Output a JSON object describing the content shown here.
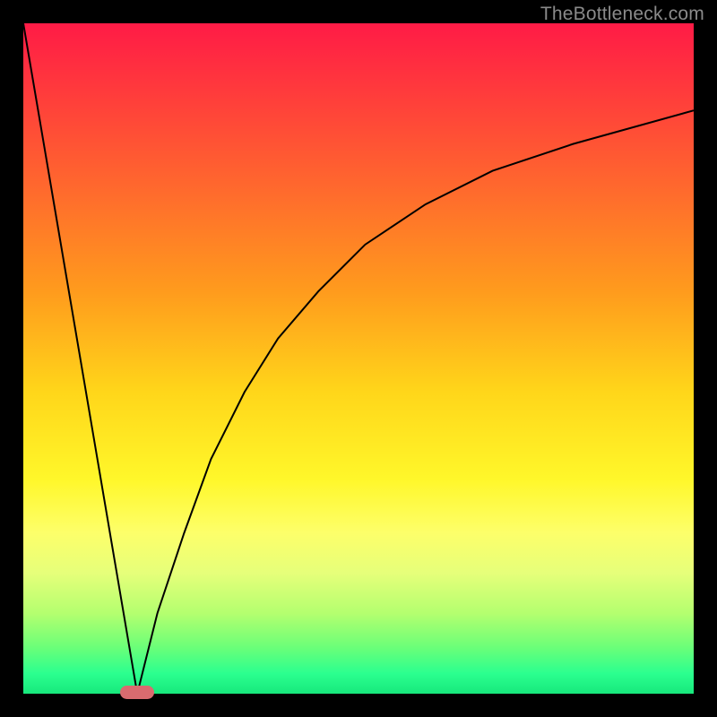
{
  "watermark": "TheBottleneck.com",
  "chart_data": {
    "type": "line",
    "title": "",
    "xlabel": "",
    "ylabel": "",
    "xlim": [
      0,
      100
    ],
    "ylim": [
      0,
      100
    ],
    "grid": false,
    "legend": false,
    "annotations": [],
    "series": [
      {
        "name": "left-branch",
        "x": [
          0,
          17
        ],
        "y": [
          100,
          0
        ]
      },
      {
        "name": "right-branch",
        "x": [
          17,
          20,
          24,
          28,
          33,
          38,
          44,
          51,
          60,
          70,
          82,
          100
        ],
        "y": [
          0,
          12,
          24,
          35,
          45,
          53,
          60,
          67,
          73,
          78,
          82,
          87
        ]
      }
    ],
    "marker": {
      "x": 17,
      "y": 0,
      "color": "#d96b6f",
      "shape": "pill"
    },
    "gradient_stops": [
      {
        "pos": 0,
        "color": "#ff1b46"
      },
      {
        "pos": 25,
        "color": "#ff6a2d"
      },
      {
        "pos": 55,
        "color": "#ffd61a"
      },
      {
        "pos": 80,
        "color": "#e6ff7a"
      },
      {
        "pos": 100,
        "color": "#17e87c"
      }
    ]
  },
  "colors": {
    "frame": "#000000",
    "curve": "#000000",
    "marker": "#d96b6f",
    "watermark": "#8a8a8a"
  }
}
